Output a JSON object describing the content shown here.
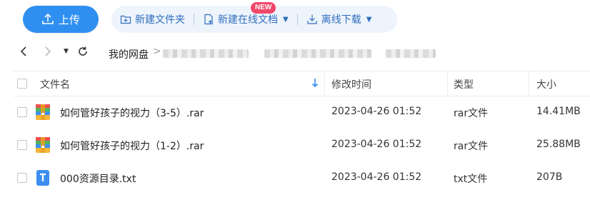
{
  "toolbar": {
    "upload_label": "上传",
    "new_folder_label": "新建文件夹",
    "new_online_doc_label": "新建在线文档",
    "new_badge": "NEW",
    "offline_download_label": "离线下载"
  },
  "breadcrumb": {
    "root": "我的网盘",
    "separator": ">"
  },
  "table": {
    "headers": {
      "name": "文件名",
      "modified": "修改时间",
      "type": "类型",
      "size": "大小"
    },
    "rows": [
      {
        "name": "如何管好孩子的视力（3-5）.rar",
        "modified": "2023-04-26 01:52",
        "type": "rar文件",
        "size": "14.41MB",
        "icon": "rar-archive-icon"
      },
      {
        "name": "如何管好孩子的视力（1-2）.rar",
        "modified": "2023-04-26 01:52",
        "type": "rar文件",
        "size": "25.88MB",
        "icon": "rar-archive-icon"
      },
      {
        "name": "000资源目录.txt",
        "modified": "2023-04-26 01:52",
        "type": "txt文件",
        "size": "207B",
        "icon": "text-file-icon"
      }
    ]
  },
  "colors": {
    "accent": "#2f8ff0",
    "toolbar_bg": "#eef4fc",
    "toolbar_text": "#2f6fbd",
    "badge": "#f2466a"
  }
}
